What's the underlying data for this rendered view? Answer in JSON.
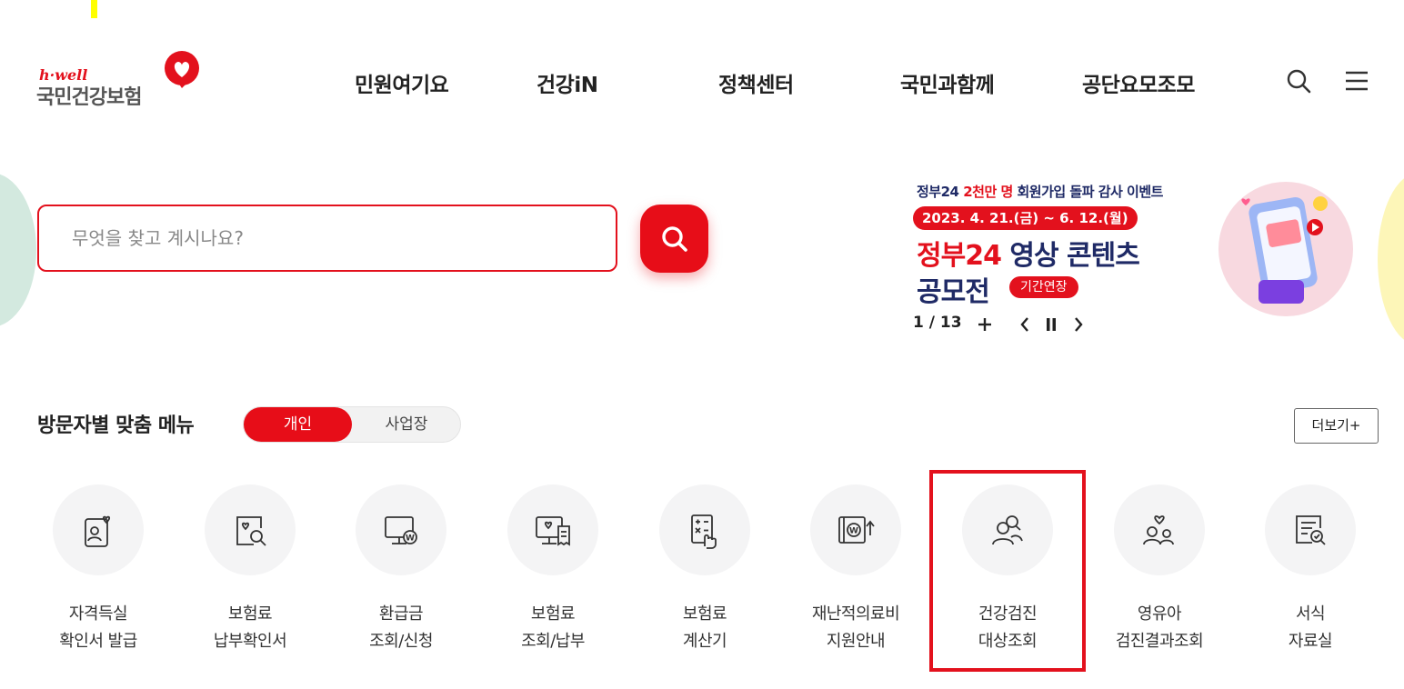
{
  "logo": {
    "en": "h·well",
    "ko": "국민건강보험"
  },
  "gnb": {
    "items": [
      {
        "label": "민원여기요"
      },
      {
        "label": "건강iN"
      },
      {
        "label": "정책센터"
      },
      {
        "label": "국민과함께"
      },
      {
        "label": "공단요모조모"
      }
    ]
  },
  "header_icons": [
    "search-icon",
    "menu-icon"
  ],
  "search": {
    "placeholder": "무엇을 찾고 계시나요?",
    "value": ""
  },
  "banner": {
    "sub_prefix": "정부24 ",
    "sub_highlight": "2천만 명",
    "sub_suffix": " 회원가입 돌파 감사 이벤트",
    "date": "2023. 4. 21.(금) ~ 6. 12.(월)",
    "title_red": "정부24",
    "title_rest": " 영상 콘텐츠",
    "title2": "공모전",
    "badge": "기간연장",
    "counter": "1 / 13",
    "controls": [
      "plus-icon",
      "prev-icon",
      "pause-icon",
      "next-icon"
    ]
  },
  "custom_menu": {
    "title": "방문자별 맞춤 메뉴",
    "tabs": [
      {
        "label": "개인",
        "active": true
      },
      {
        "label": "사업장",
        "active": false
      }
    ],
    "more": "더보기+",
    "items": [
      {
        "line1": "자격득실",
        "line2": "확인서 발급",
        "icon": "id-card-heart-icon"
      },
      {
        "line1": "보험료",
        "line2": "납부확인서",
        "icon": "document-search-icon"
      },
      {
        "line1": "환급금",
        "line2": "조회/신청",
        "icon": "monitor-won-icon"
      },
      {
        "line1": "보험료",
        "line2": "조회/납부",
        "icon": "monitor-receipt-icon"
      },
      {
        "line1": "보험료",
        "line2": "계산기",
        "icon": "calculator-hand-icon"
      },
      {
        "line1": "재난적의료비",
        "line2": "지원안내",
        "icon": "wallet-won-icon"
      },
      {
        "line1": "건강검진",
        "line2": "대상조회",
        "icon": "people-search-icon"
      },
      {
        "line1": "영유아",
        "line2": "검진결과조회",
        "icon": "family-heart-icon"
      },
      {
        "line1": "서식",
        "line2": "자료실",
        "icon": "form-search-icon"
      }
    ]
  },
  "colors": {
    "brand_red": "#e3111d",
    "navy": "#1f2a66",
    "circle_bg": "#f4f4f5"
  }
}
